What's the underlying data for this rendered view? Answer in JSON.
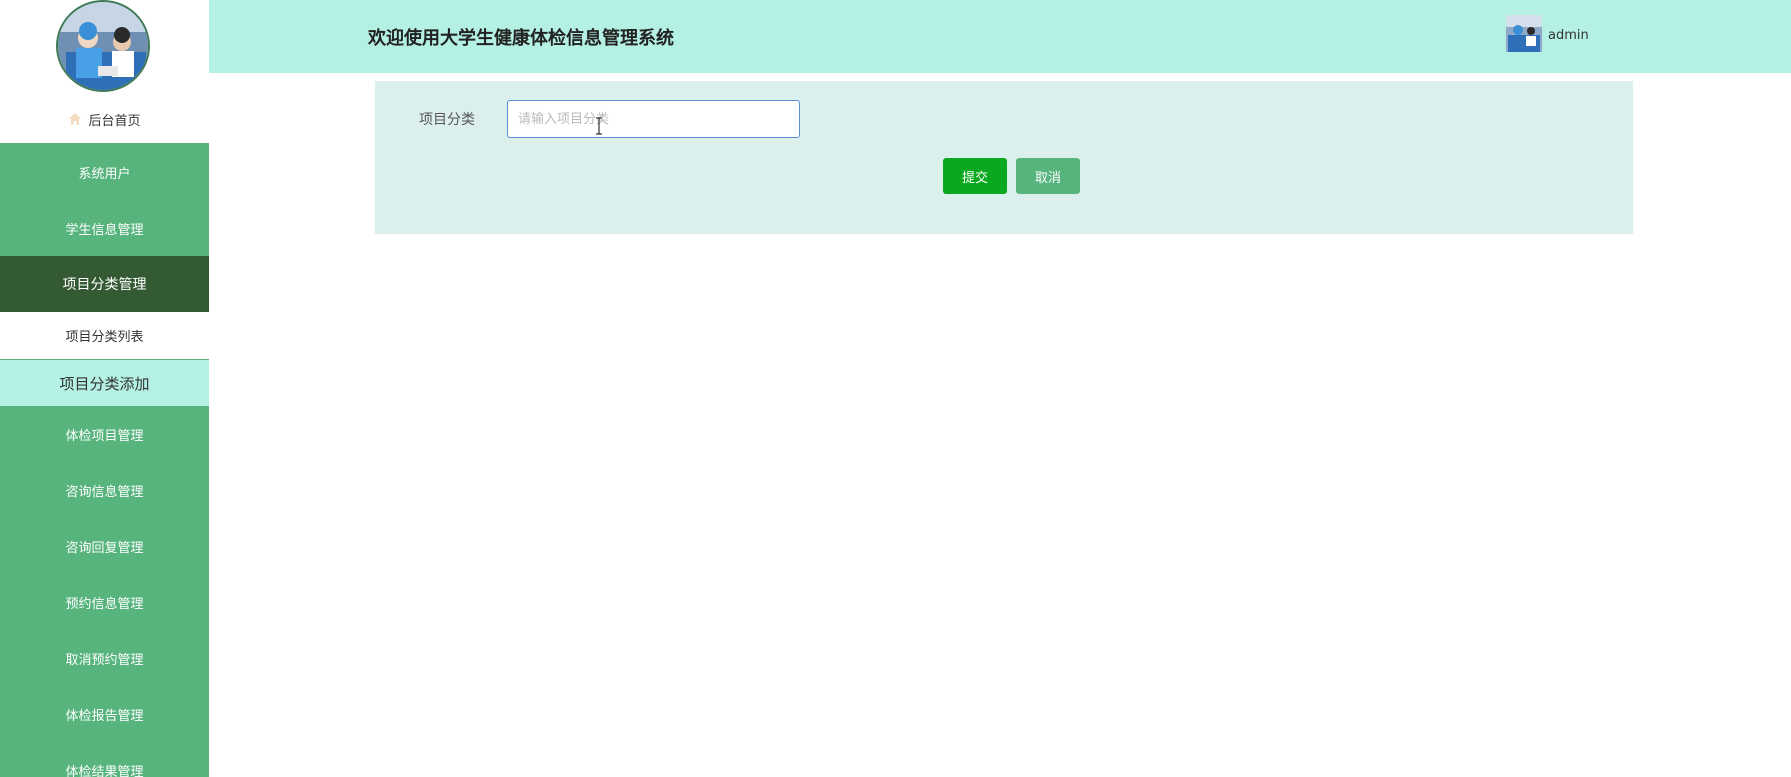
{
  "header": {
    "title": "欢迎使用大学生健康体检信息管理系统",
    "username": "admin"
  },
  "sidebar": {
    "home_label": "后台首页",
    "items": [
      {
        "label": "系统用户"
      },
      {
        "label": "学生信息管理"
      },
      {
        "label": "项目分类管理",
        "active": true
      },
      {
        "label": "体检项目管理"
      },
      {
        "label": "咨询信息管理"
      },
      {
        "label": "咨询回复管理"
      },
      {
        "label": "预约信息管理"
      },
      {
        "label": "取消预约管理"
      },
      {
        "label": "体检报告管理"
      },
      {
        "label": "体检结果管理"
      }
    ],
    "sub_items": [
      {
        "label": "项目分类列表"
      },
      {
        "label": "项目分类添加",
        "current": true
      }
    ]
  },
  "form": {
    "field_label": "项目分类",
    "field_placeholder": "请输入项目分类",
    "field_value": "",
    "submit_label": "提交",
    "cancel_label": "取消"
  },
  "colors": {
    "sidebar": "#56b47c",
    "sidebar_active": "#345a34",
    "header": "#b4f1e4",
    "panel": "#dbefec",
    "submit": "#0aa81e"
  }
}
